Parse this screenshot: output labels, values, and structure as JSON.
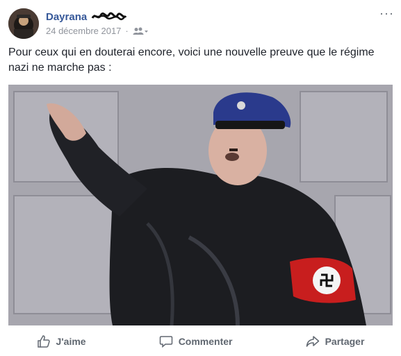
{
  "post": {
    "author": "Dayrana",
    "date": "24 décembre 2017",
    "separator": "·",
    "text": "Pour ceux qui en douterai encore, voici une nouvelle preuve que le régime nazi ne marche pas :",
    "more_label": "···",
    "audience_icon": "friends-icon"
  },
  "actions": {
    "like": "J'aime",
    "comment": "Commenter",
    "share": "Partager"
  },
  "colors": {
    "author": "#365899",
    "meta": "#90949c",
    "action": "#606770"
  }
}
